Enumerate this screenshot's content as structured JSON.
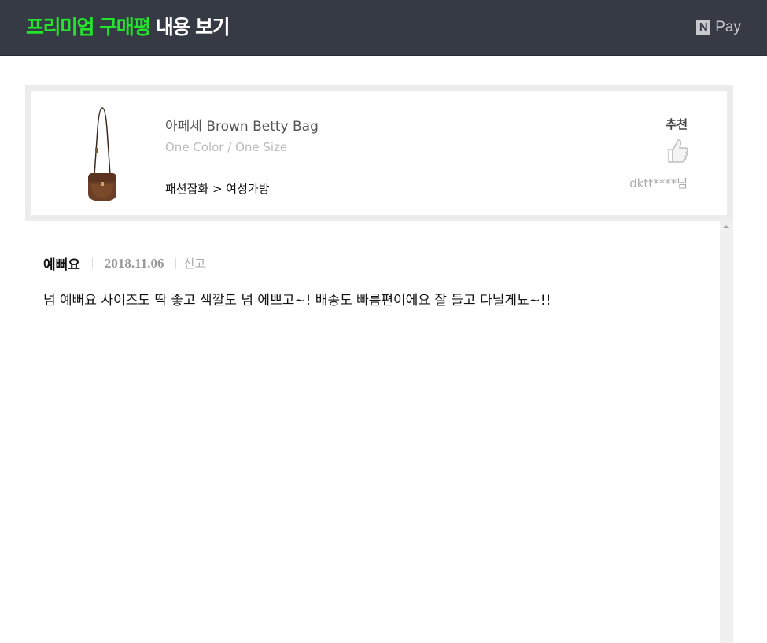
{
  "header": {
    "title_accent": "프리미엄 구매평",
    "title_rest": " 내용 보기",
    "pay_logo": "N",
    "pay_text": "Pay",
    "accent_color": "#24e32c",
    "background_color": "#363a45"
  },
  "product": {
    "image_icon": "brown-crossbody-bag-image",
    "name": "아페세 Brown Betty Bag",
    "option": "One Color / One Size",
    "category": "패션잡화 > 여성가방",
    "recommend_label": "추천",
    "recommend_icon": "thumbs-up-icon",
    "reviewer": "dktt****님"
  },
  "review": {
    "title": "예뻐요",
    "date": "2018.11.06",
    "report_label": "신고",
    "body": "넘 예뻐요 사이즈도 딱 좋고 색깔도 넘 에쁘고~! 배송도 빠름편이에요 잘 들고 다닐게뇨~!!"
  }
}
